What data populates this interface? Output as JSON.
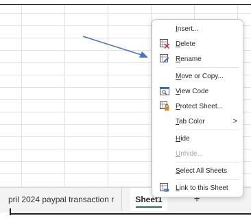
{
  "context_menu": {
    "items": [
      {
        "label": "Insert...",
        "icon": "",
        "disabled": false
      },
      {
        "label": "Delete",
        "icon": "delete-sheet-icon",
        "disabled": false
      },
      {
        "label": "Rename",
        "icon": "rename-icon",
        "disabled": false
      },
      {
        "label": "Move or Copy...",
        "icon": "",
        "disabled": false
      },
      {
        "label": "View Code",
        "icon": "view-code-icon",
        "disabled": false
      },
      {
        "label": "Protect Sheet...",
        "icon": "protect-sheet-icon",
        "disabled": false
      },
      {
        "label": "Tab Color",
        "icon": "",
        "disabled": false,
        "submenu": true,
        "submenu_glyph": ">"
      },
      {
        "label": "Hide",
        "icon": "",
        "disabled": false
      },
      {
        "label": "Unhide...",
        "icon": "",
        "disabled": true
      },
      {
        "label": "Select All Sheets",
        "icon": "",
        "disabled": false
      },
      {
        "label": "Link to this Sheet",
        "icon": "link-sheet-icon",
        "disabled": false
      }
    ]
  },
  "sheet_tabs": {
    "tabs": [
      {
        "label": "pril 2024 paypal transaction r",
        "active": false
      },
      {
        "label": "Sheet1",
        "active": true
      }
    ],
    "add_sheet": "+"
  },
  "colors": {
    "active_tab_underline": "#1e7a41",
    "arrow": "#4a72c4",
    "delete_icon": "#d13438",
    "rename_icon": "#3b6fc9",
    "protect_lock": "#d98a1f"
  }
}
